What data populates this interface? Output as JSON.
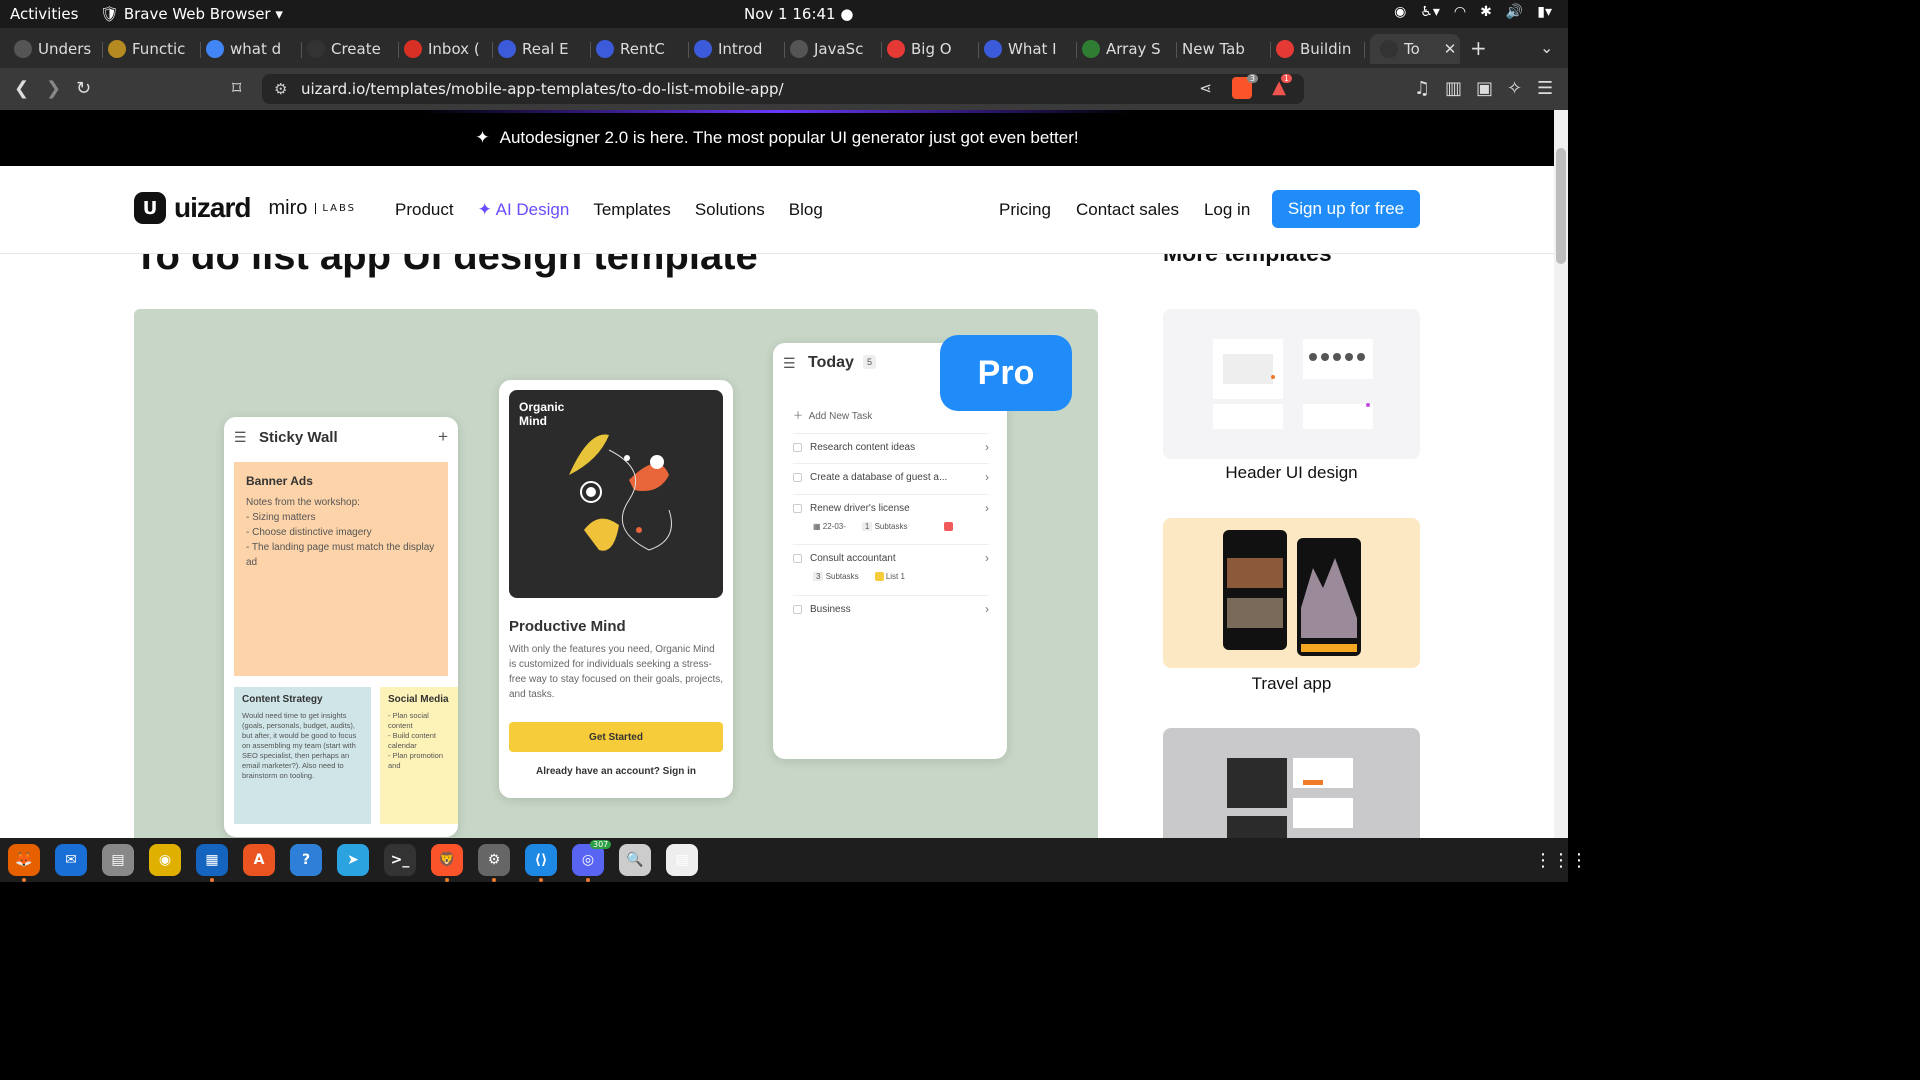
{
  "system": {
    "activities": "Activities",
    "app_name": "Brave Web Browser",
    "clock": "Nov 1  16:41"
  },
  "tabs": [
    {
      "label": "Unders",
      "fav": "#555"
    },
    {
      "label": "Functic",
      "fav": "#b58a20"
    },
    {
      "label": "what d",
      "fav": "#4285f4"
    },
    {
      "label": "Create",
      "fav": "#333"
    },
    {
      "label": "Inbox (",
      "fav": "#d93025"
    },
    {
      "label": "Real E",
      "fav": "#3b5bdb"
    },
    {
      "label": "RentC",
      "fav": "#3b5bdb"
    },
    {
      "label": "Introd",
      "fav": "#3b5bdb"
    },
    {
      "label": "JavaSc",
      "fav": "#555"
    },
    {
      "label": "Big O",
      "fav": "#e53935"
    },
    {
      "label": "What I",
      "fav": "#3b5bdb"
    },
    {
      "label": "Array S",
      "fav": "#2e7d32"
    },
    {
      "label": "New Tab",
      "fav": ""
    },
    {
      "label": "Buildin",
      "fav": "#e53935"
    },
    {
      "label": "To",
      "fav": "#333"
    }
  ],
  "address": {
    "url": "uizard.io/templates/mobile-app-templates/to-do-list-mobile-app/"
  },
  "toolbar": {
    "shields_count": "3",
    "alerts_count": "1"
  },
  "banner": {
    "text": "Autodesigner 2.0 is here. The most popular UI generator just got even better!"
  },
  "header": {
    "logo": "uizard",
    "partner": "miro",
    "partner_sub": "LABS",
    "nav": [
      "Product",
      "AI Design",
      "Templates",
      "Solutions",
      "Blog"
    ],
    "right_nav": [
      "Pricing",
      "Contact sales",
      "Log in"
    ],
    "signup": "Sign up for free"
  },
  "main": {
    "title": "To do list app UI design template",
    "more_title": "More templates"
  },
  "hero": {
    "pro_badge": "Pro",
    "sticky": {
      "title": "Sticky Wall",
      "note1_title": "Banner Ads",
      "note1_body": "Notes from the workshop:\n- Sizing matters\n- Choose distinctive imagery\n- The landing page must match the display ad",
      "note2_title": "Content Strategy",
      "note2_body": "Would need time to get insights (goals, personals, budget, audits), but after, it would be good to focus on assembling my team (start with SEO specialist, then perhaps an email marketer?). Also need to brainstorm on tooling.",
      "note3_title": "Social Media",
      "note3_body": "- Plan social content\n- Build content calendar\n- Plan promotion and"
    },
    "organic": {
      "art_label": "Organic\nMind",
      "title": "Productive Mind",
      "desc": "With only the features you need, Organic Mind is customized for individuals seeking a stress-free way to stay focused on their goals, projects, and tasks.",
      "button": "Get Started",
      "signin": "Already have an account? Sign in"
    },
    "today": {
      "title": "Today",
      "count": "5",
      "add": "Add New Task",
      "tasks": [
        {
          "label": "Research content ideas"
        },
        {
          "label": "Create a database of guest a..."
        },
        {
          "label": "Renew driver's license",
          "date": "22-03-",
          "subtasks_n": "1",
          "subtasks": "Subtasks"
        },
        {
          "label": "Consult accountant",
          "subtasks_n": "3",
          "subtasks": "Subtasks",
          "list": "List 1"
        },
        {
          "label": "Business"
        }
      ]
    }
  },
  "templates": [
    {
      "label": "Header UI design",
      "bg": "#f4f4f6"
    },
    {
      "label": "Travel app",
      "bg": "#fde8c4"
    },
    {
      "label": "",
      "bg": "#c9c9cb"
    }
  ],
  "dock": {
    "discord_badge": "307",
    "apps": [
      {
        "name": "firefox-icon",
        "color": "#e66000",
        "glyph": "🦊"
      },
      {
        "name": "thunderbird-icon",
        "color": "#1a6fd6",
        "glyph": "✉"
      },
      {
        "name": "files-icon",
        "color": "#888",
        "glyph": "▤"
      },
      {
        "name": "rhythmbox-icon",
        "color": "#e0b000",
        "glyph": "◉"
      },
      {
        "name": "writer-icon",
        "color": "#1565c0",
        "glyph": "▦"
      },
      {
        "name": "software-icon",
        "color": "#e95420",
        "glyph": "A"
      },
      {
        "name": "help-icon",
        "color": "#2d7fd8",
        "glyph": "?"
      },
      {
        "name": "telegram-icon",
        "color": "#2aa3e0",
        "glyph": "➤"
      },
      {
        "name": "terminal-icon",
        "color": "#333",
        "glyph": ">_"
      },
      {
        "name": "brave-icon",
        "color": "#fb542b",
        "glyph": "🦁"
      },
      {
        "name": "settings-icon",
        "color": "#666",
        "glyph": "⚙"
      },
      {
        "name": "vscode-icon",
        "color": "#1e88e5",
        "glyph": "⟨⟩"
      },
      {
        "name": "discord-icon",
        "color": "#5865f2",
        "glyph": "◎"
      },
      {
        "name": "image-viewer-icon",
        "color": "#ccc",
        "glyph": "🔍"
      },
      {
        "name": "text-editor-icon",
        "color": "#eee",
        "glyph": "▤"
      }
    ]
  }
}
